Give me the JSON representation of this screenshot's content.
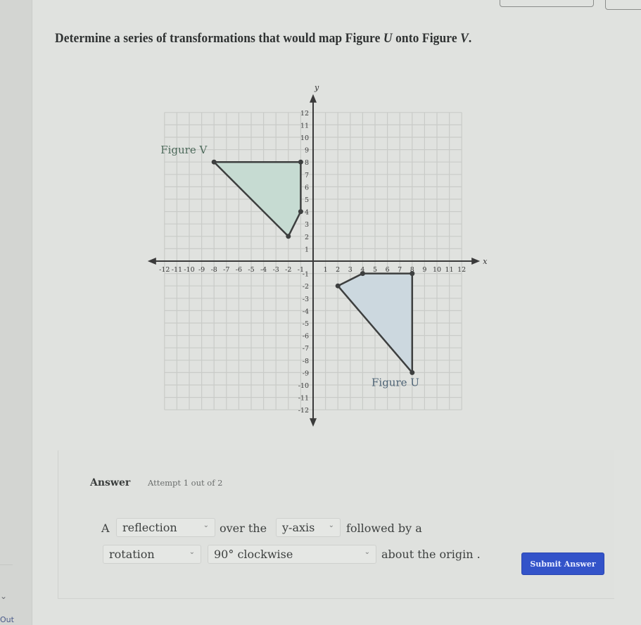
{
  "question": {
    "prefix": "Determine a series of transformations that would map Figure ",
    "figure_from": "U",
    "middle": " onto Figure ",
    "figure_to": "V",
    "suffix": "."
  },
  "graph": {
    "x_axis_label": "x",
    "y_axis_label": "y",
    "x_ticks": [
      -12,
      -11,
      -10,
      -9,
      -8,
      -7,
      -6,
      -5,
      -4,
      -3,
      -2,
      -1,
      1,
      2,
      3,
      4,
      5,
      6,
      7,
      8,
      9,
      10,
      11,
      12
    ],
    "y_ticks": [
      -12,
      -11,
      -10,
      -9,
      -8,
      -7,
      -6,
      -5,
      -4,
      -3,
      -2,
      -1,
      1,
      2,
      3,
      4,
      5,
      6,
      7,
      8,
      9,
      10,
      11,
      12
    ],
    "range": {
      "xmin": -12,
      "xmax": 12,
      "ymin": -12,
      "ymax": 12
    },
    "figures": [
      {
        "name": "Figure V",
        "vertices": [
          [
            -8,
            8
          ],
          [
            -1,
            8
          ],
          [
            -1,
            4
          ],
          [
            -2,
            2
          ]
        ],
        "fill": "#c6dbd2",
        "label_anchor": "top-left"
      },
      {
        "name": "Figure U",
        "vertices": [
          [
            2,
            -2
          ],
          [
            4,
            -1
          ],
          [
            8,
            -1
          ],
          [
            8,
            -9
          ]
        ],
        "fill": "#ccd8df",
        "label_anchor": "bottom"
      }
    ]
  },
  "answer": {
    "title": "Answer",
    "attempt": "Attempt 1 out of 2",
    "word_a": "A",
    "dropdown1": "reflection",
    "word_over": "over the",
    "dropdown2": "y-axis",
    "word_followed": "followed by a",
    "dropdown3": "rotation",
    "dropdown4": "90° clockwise",
    "word_about": "about the origin .",
    "submit": "Submit Answer"
  },
  "sidebar": {
    "bottom_text": "Out"
  },
  "colors": {
    "submit_bg": "#3353c9",
    "axis": "#3a3a3a",
    "grid": "#c9cbc8"
  }
}
